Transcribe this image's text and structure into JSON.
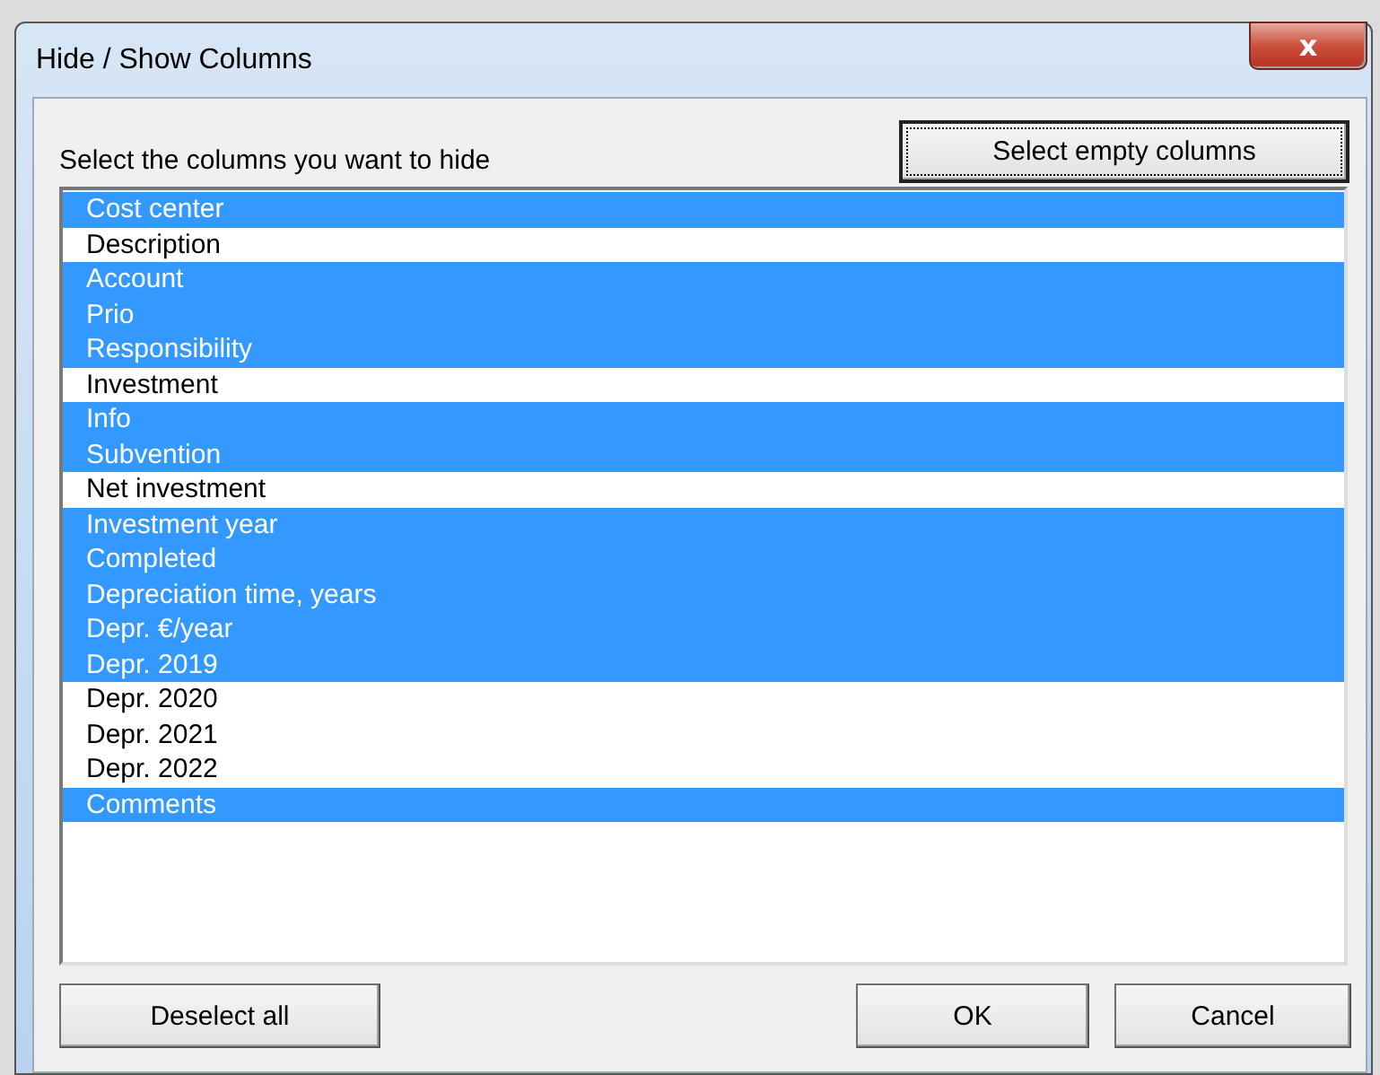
{
  "window": {
    "title": "Hide / Show Columns",
    "close_label": "x"
  },
  "prompt": "Select the columns you want to hide",
  "select_empty_button": "Select empty columns",
  "columns": [
    {
      "label": "Cost center",
      "selected": true
    },
    {
      "label": "Description",
      "selected": false
    },
    {
      "label": "Account",
      "selected": true
    },
    {
      "label": "Prio",
      "selected": true
    },
    {
      "label": "Responsibility",
      "selected": true
    },
    {
      "label": "Investment",
      "selected": false
    },
    {
      "label": "Info",
      "selected": true
    },
    {
      "label": "Subvention",
      "selected": true
    },
    {
      "label": "Net investment",
      "selected": false
    },
    {
      "label": "Investment year",
      "selected": true
    },
    {
      "label": "Completed",
      "selected": true
    },
    {
      "label": "Depreciation time, years",
      "selected": true
    },
    {
      "label": "Depr. €/year",
      "selected": true
    },
    {
      "label": "Depr. 2019",
      "selected": true
    },
    {
      "label": "Depr. 2020",
      "selected": false
    },
    {
      "label": "Depr. 2021",
      "selected": false
    },
    {
      "label": "Depr. 2022",
      "selected": false
    },
    {
      "label": "Comments",
      "selected": true
    }
  ],
  "buttons": [
    "Deselect all",
    "OK",
    "Cancel"
  ]
}
